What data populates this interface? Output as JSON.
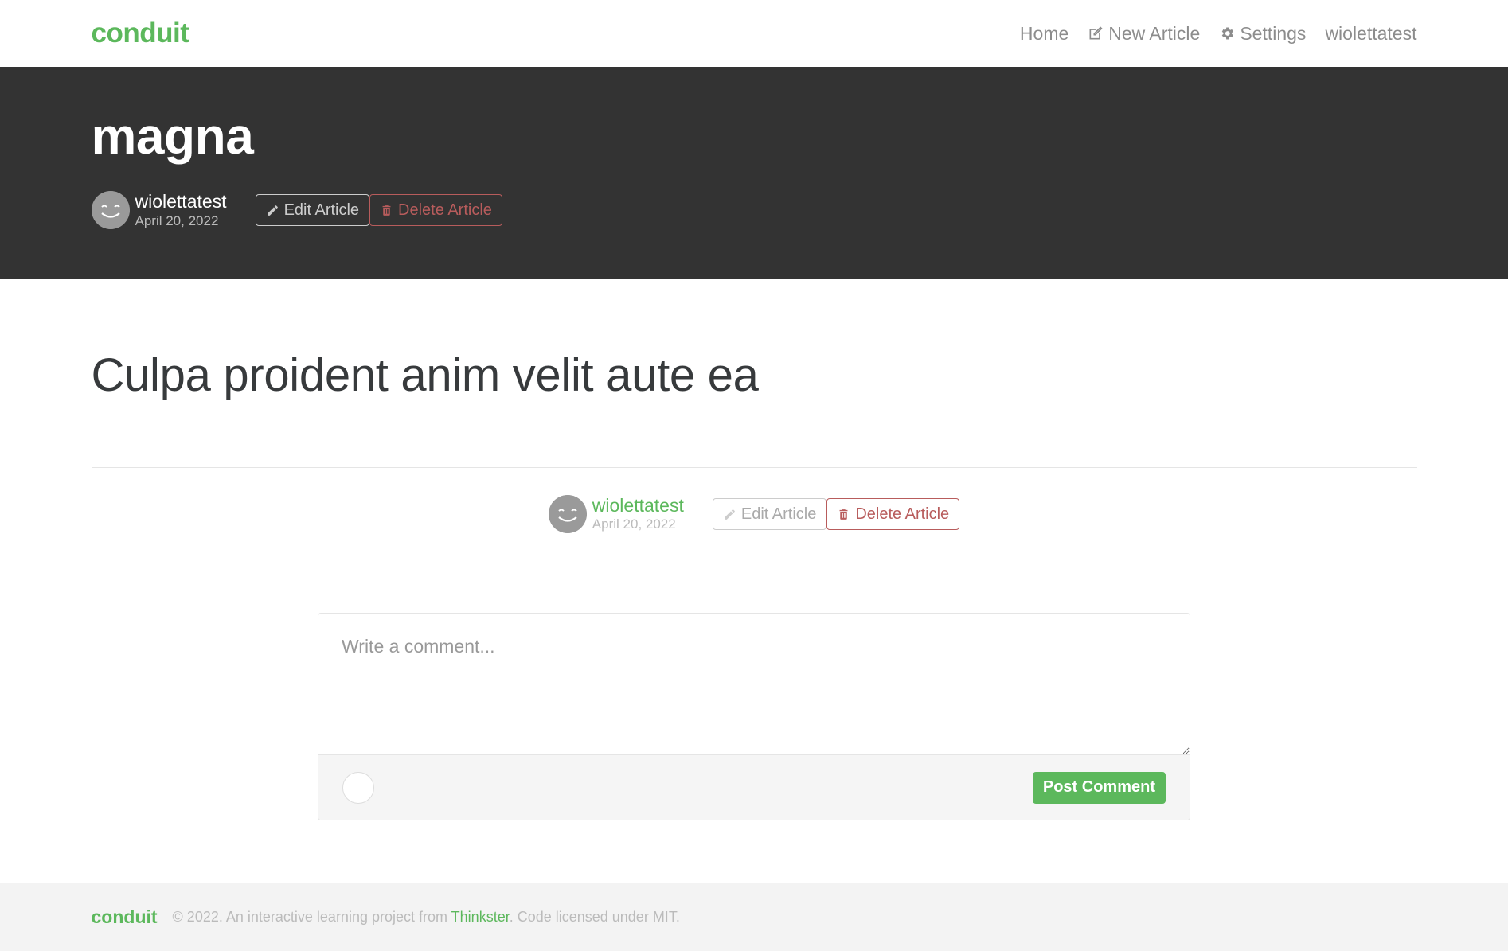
{
  "navbar": {
    "brand": "conduit",
    "links": [
      {
        "label": "Home"
      },
      {
        "label": "New Article",
        "icon": "compose-icon"
      },
      {
        "label": "Settings",
        "icon": "gear-icon"
      },
      {
        "label": "wiolettatest"
      }
    ]
  },
  "banner": {
    "title": "magna",
    "author": "wiolettatest",
    "date": "April 20, 2022",
    "edit_label": "Edit Article",
    "delete_label": "Delete Article"
  },
  "article": {
    "body": "Culpa proident anim velit aute ea",
    "author": "wiolettatest",
    "date": "April 20, 2022",
    "edit_label": "Edit Article",
    "delete_label": "Delete Article"
  },
  "comment_form": {
    "placeholder": "Write a comment...",
    "post_label": "Post Comment"
  },
  "footer": {
    "brand": "conduit",
    "text_before": "© 2022. An interactive learning project from ",
    "link": "Thinkster",
    "text_after": ". Code licensed under MIT."
  },
  "colors": {
    "brand_green": "#5cb85c",
    "banner_bg": "#333333",
    "danger": "#b85c5c"
  }
}
